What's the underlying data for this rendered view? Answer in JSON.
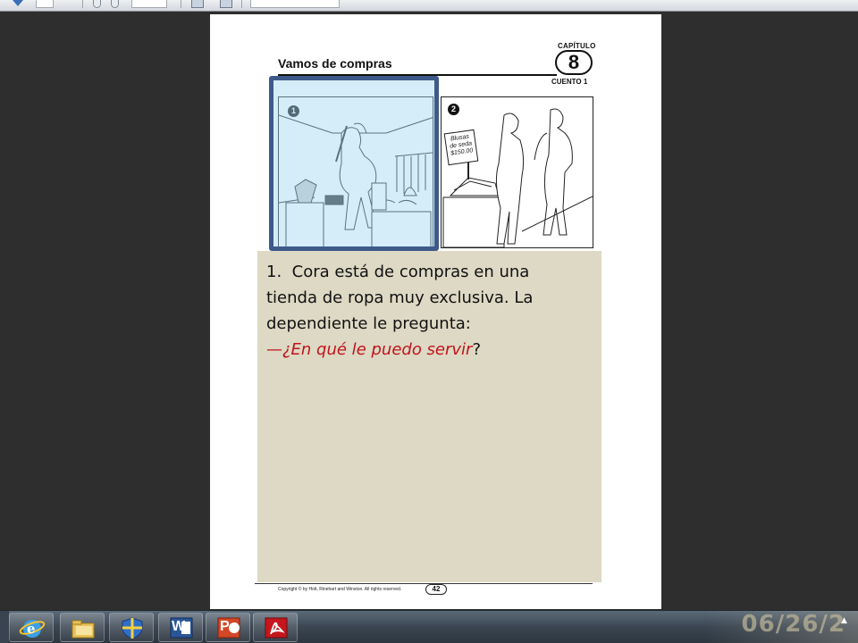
{
  "worksheet": {
    "title": "Vamos de compras",
    "chapter_label": "CAPÍTULO",
    "chapter_number": "8",
    "story_label": "CUENTO 1",
    "panels": [
      {
        "number": "1"
      },
      {
        "number": "2",
        "sign_lines": [
          "Blusas",
          "de seda",
          "$150.00"
        ]
      }
    ],
    "copyright": "Copyright © by Holt, Rinehart and Winston. All rights reserved.",
    "page_number": "42"
  },
  "caption": {
    "number": "1.",
    "lines": [
      "Cora está de compras en una",
      "tienda de ropa muy exclusiva. La",
      "dependiente le pregunta:"
    ],
    "dash": "—",
    "quote": "¿En qué le puedo servir",
    "question_mark": "?"
  },
  "taskbar": {
    "apps": [
      {
        "icon": "internet-explorer-icon"
      },
      {
        "icon": "folder-icon"
      },
      {
        "icon": "shield-icon"
      },
      {
        "icon": "word-icon",
        "label": "W"
      },
      {
        "icon": "powerpoint-icon",
        "label": "P"
      },
      {
        "icon": "acrobat-icon"
      }
    ],
    "clock": "06/26/2"
  },
  "colors": {
    "highlight_border": "#3d5a8a",
    "highlight_fill": "#a0d7f0",
    "caption_bg": "#ddd9c4",
    "quote_text": "#c0141d"
  }
}
